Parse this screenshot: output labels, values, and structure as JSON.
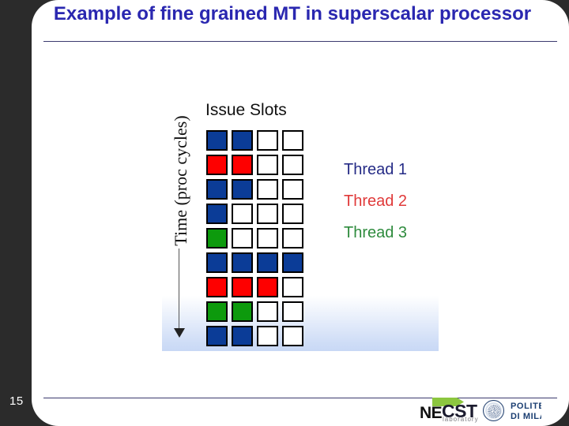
{
  "slide": {
    "title": "Example of fine grained MT in superscalar processor",
    "page_number": "15",
    "title_color": "#2a27b0",
    "rule_color": "#3b3a6e",
    "sidebar_color": "#2b2b2b"
  },
  "diagram": {
    "y_axis_label": "Time (proc cycles)",
    "x_axis_label": "Issue Slots",
    "arrow_icon": "down-arrow-icon",
    "columns": 4,
    "rows": 9,
    "colors": {
      "blue": "#0b3c97",
      "red": "#fe0000",
      "green": "#0d9a0d",
      "empty": "#ffffff",
      "cell_border": "#000000"
    },
    "grid": [
      [
        "blue",
        "blue",
        "empty",
        "empty"
      ],
      [
        "red",
        "red",
        "empty",
        "empty"
      ],
      [
        "blue",
        "blue",
        "empty",
        "empty"
      ],
      [
        "blue",
        "empty",
        "empty",
        "empty"
      ],
      [
        "green",
        "empty",
        "empty",
        "empty"
      ],
      [
        "blue",
        "blue",
        "blue",
        "blue"
      ],
      [
        "red",
        "red",
        "red",
        "empty"
      ],
      [
        "green",
        "green",
        "empty",
        "empty"
      ],
      [
        "blue",
        "blue",
        "empty",
        "empty"
      ]
    ],
    "legend": [
      {
        "label": "Thread 1",
        "color": "#252b86"
      },
      {
        "label": "Thread 2",
        "color": "#e03a3a"
      },
      {
        "label": "Thread 3",
        "color": "#2e8b3d"
      }
    ]
  },
  "footer": {
    "necst": {
      "ne": "NE",
      "cst": "CST",
      "laboratory": "laboratory",
      "arrow_color": "#8cc63f"
    },
    "polimi": {
      "line1": "POLITECNICO",
      "line2": "DI MILANO",
      "color": "#1c3f72",
      "seal_icon": "polimi-seal-icon"
    }
  }
}
